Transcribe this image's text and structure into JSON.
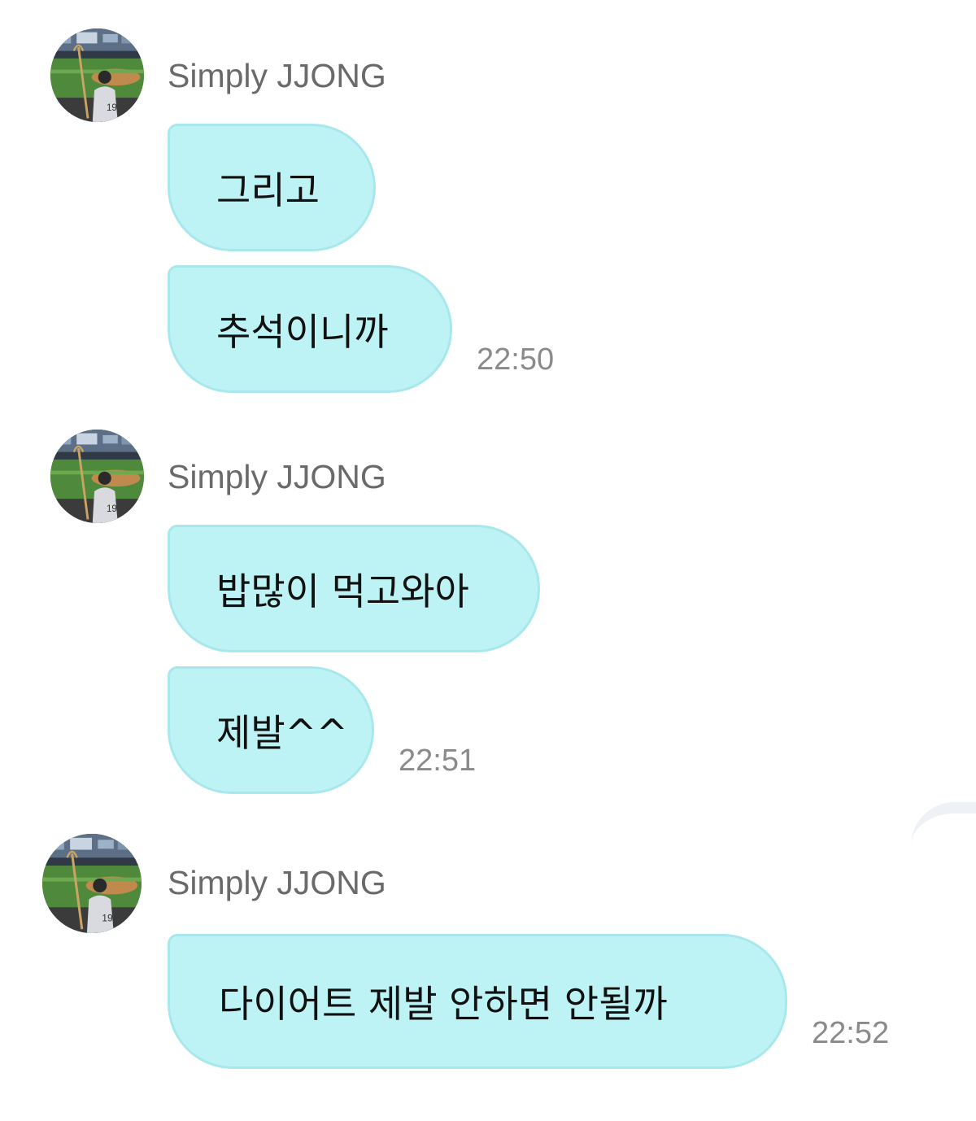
{
  "chat": {
    "groups": [
      {
        "sender": "Simply JJONG",
        "avatar_icon": "baseball-stadium-avatar-icon",
        "messages": [
          {
            "text": "그리고"
          },
          {
            "text": "추석이니까"
          }
        ],
        "time": "22:50"
      },
      {
        "sender": "Simply JJONG",
        "avatar_icon": "baseball-stadium-avatar-icon",
        "messages": [
          {
            "text": "밥많이 먹고와아"
          },
          {
            "text": "제발^^"
          }
        ],
        "time": "22:51"
      },
      {
        "sender": "Simply JJONG",
        "avatar_icon": "baseball-stadium-avatar-icon",
        "messages": [
          {
            "text": "다이어트 제발 안하면 안될까"
          }
        ],
        "time": "22:52"
      }
    ]
  },
  "colors": {
    "bubble_fill": "#bdf3f5",
    "bubble_border": "#a8e8ec",
    "name_text": "#6a6a6a",
    "time_text": "#8a8a8a"
  }
}
